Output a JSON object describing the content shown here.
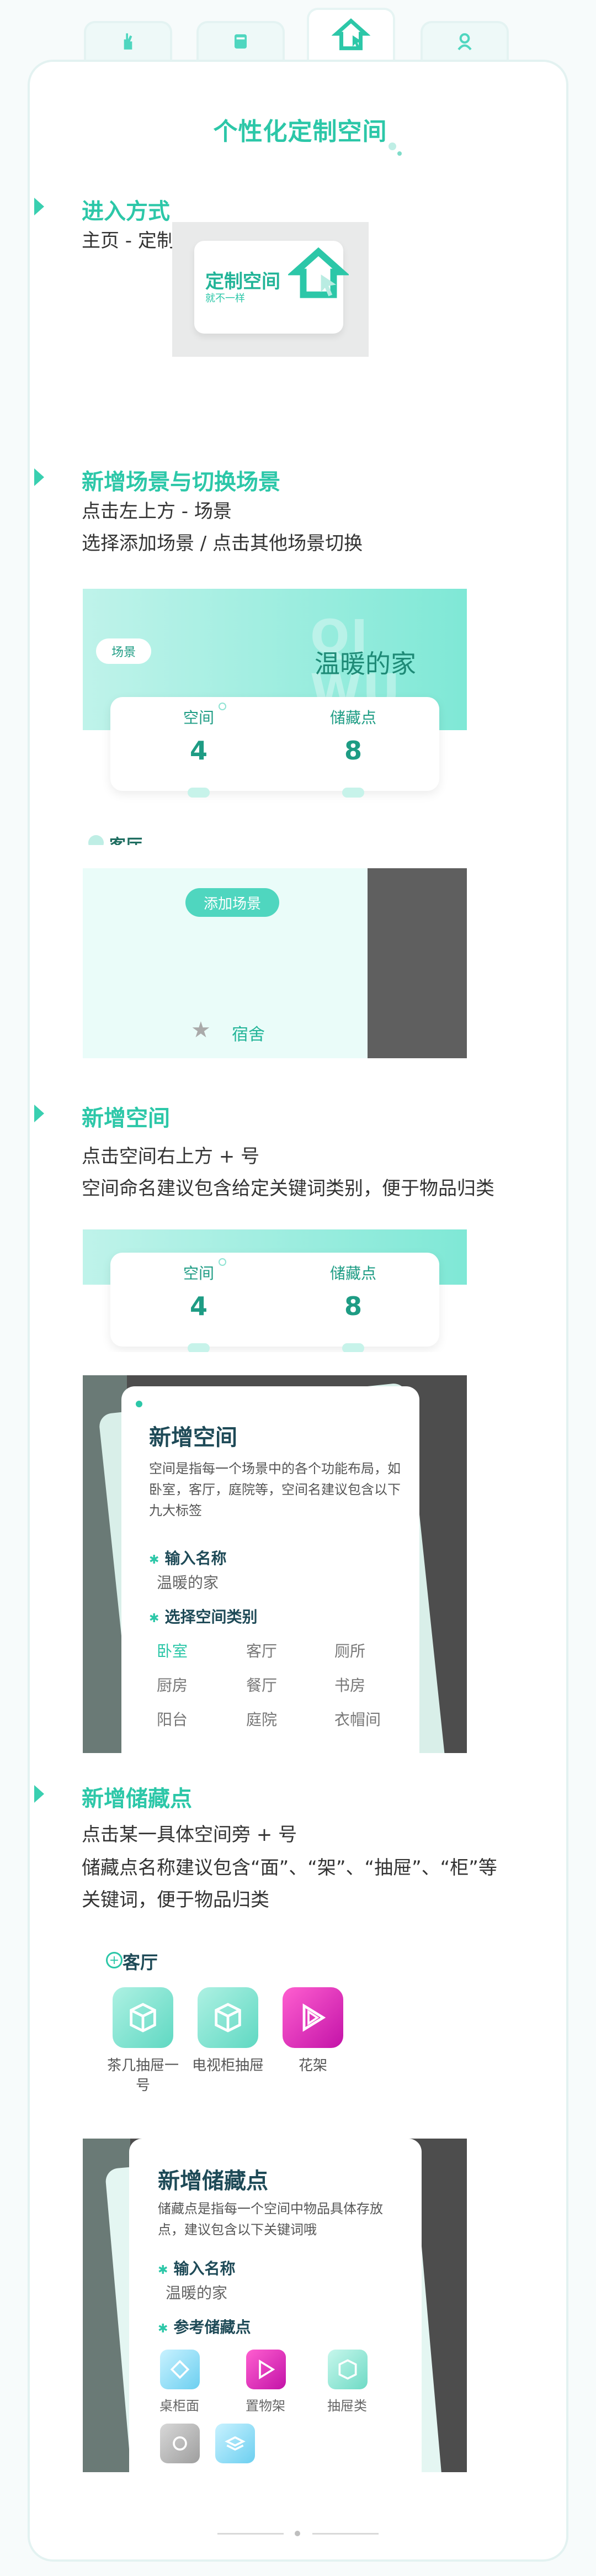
{
  "tabs": [
    {
      "name": "tab-1",
      "icon": "hand-icon"
    },
    {
      "name": "tab-2",
      "icon": "box-icon"
    },
    {
      "name": "tab-3",
      "icon": "home-cursor-icon",
      "active": true
    },
    {
      "name": "tab-4",
      "icon": "user-icon"
    }
  ],
  "page_title": "个性化定制空间",
  "sections": {
    "entry": {
      "heading": "进入方式",
      "text": "主页 - 定制空间",
      "card_title": "定制空间",
      "card_sub": "就不一样"
    },
    "scene": {
      "heading": "新增场景与切换场景",
      "line1": "点击左上方 - 场景",
      "line2": "选择添加场景 / 点击其他场景切换",
      "tag": "场景",
      "ghost": "QI WU",
      "home_name": "温暖的家",
      "stat_space_label": "空间",
      "stat_space_value": "4",
      "stat_storage_label": "储藏点",
      "stat_storage_value": "8",
      "room": "客厅",
      "add_scene_button": "添加场景",
      "dorm": "宿舍"
    },
    "space": {
      "heading": "新增空间",
      "line1": "点击空间右上方 + 号",
      "line2": "空间命名建议包含给定关键词类别，便于物品归类",
      "stat_space_label": "空间",
      "stat_space_value": "4",
      "stat_storage_label": "储藏点",
      "stat_storage_value": "8",
      "modal_title": "新增空间",
      "modal_desc": "空间是指每一个场景中的各个功能布局，如卧室，客厅，庭院等，空间名建议包含以下九大标签",
      "name_label": "输入名称",
      "name_value": "温暖的家",
      "type_label": "选择空间类别",
      "types": [
        "卧室",
        "客厅",
        "厕所",
        "厨房",
        "餐厅",
        "书房",
        "阳台",
        "庭院",
        "衣帽间"
      ]
    },
    "storage": {
      "heading": "新增储藏点",
      "line1": "点击某一具体空间旁 + 号",
      "line2": "储藏点名称建议包含“面”、“架”、“抽屉”、“柜”等",
      "line3": "关键词，便于物品归类",
      "room": "客厅",
      "items": [
        "茶几抽屉一号",
        "电视柜抽屉",
        "花架"
      ],
      "modal_title": "新增储藏点",
      "modal_desc": "储藏点是指每一个空间中物品具体存放点，建议包含以下关键词哦",
      "name_label": "输入名称",
      "name_value": "温暖的家",
      "ref_label": "参考储藏点",
      "refs": [
        "桌柜面",
        "置物架",
        "抽屉类"
      ]
    }
  },
  "colors": {
    "accent": "#2cc7a8",
    "magenta": "#c313a8",
    "dark_text": "#1e4a57"
  }
}
